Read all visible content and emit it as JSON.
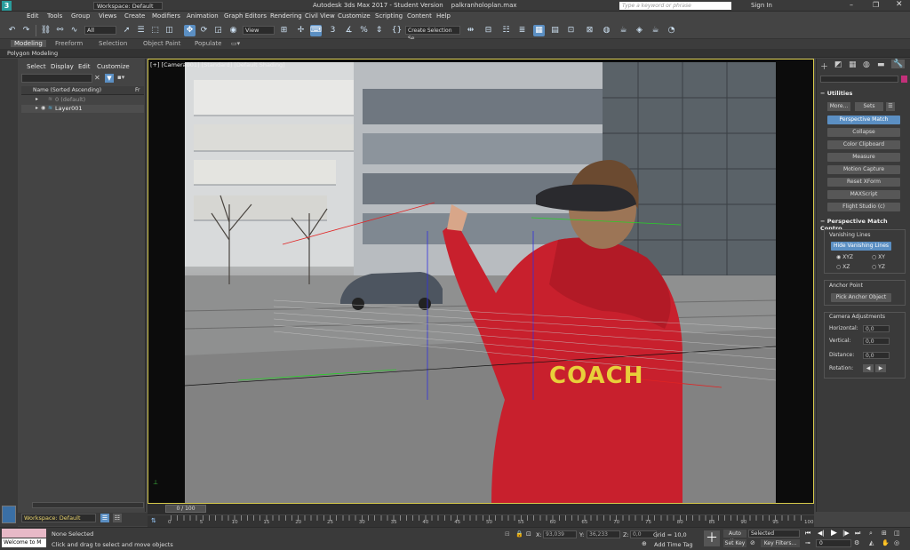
{
  "title": {
    "workspace": "Workspace: Default",
    "window_title": "Autodesk 3ds Max 2017 - Student Version",
    "file": "palkranholoplan.max",
    "search_placeholder": "Type a keyword or phrase",
    "signin": "Sign In"
  },
  "menu": [
    "Edit",
    "Tools",
    "Group",
    "Views",
    "Create",
    "Modifiers",
    "Animation",
    "Graph Editors",
    "Rendering",
    "Civil View",
    "Customize",
    "Scripting",
    "Content",
    "Help"
  ],
  "toolbar": {
    "filter": "All",
    "view": "View",
    "snap": "3",
    "selection_set": "Create Selection Se"
  },
  "ribbon": {
    "tabs": [
      "Modeling",
      "Freeform",
      "Selection",
      "Object Paint",
      "Populate"
    ],
    "sub": "Polygon Modeling"
  },
  "scene": {
    "menu": [
      "Select",
      "Display",
      "Edit",
      "Customize"
    ],
    "column": "Name (Sorted Ascending)",
    "col2": "Fr",
    "rows": [
      "0 (default)",
      "Layer001"
    ],
    "footer_workspace": "Workspace: Default"
  },
  "viewport": {
    "label": "[+] [Camera001] [Standard] [Default Shading]",
    "hoodie_text": "COACH"
  },
  "cmd": {
    "section_utilities": "Utilities",
    "more": "More...",
    "sets": "Sets",
    "buttons": [
      "Perspective Match",
      "Collapse",
      "Color Clipboard",
      "Measure",
      "Motion Capture",
      "Reset XForm",
      "MAXScript",
      "Flight Studio (c)"
    ],
    "section_pm": "Perspective Match Contro",
    "vanishing": "Vanishing Lines",
    "hide_lines": "Hide Vanishing Lines",
    "radio": [
      "XYZ",
      "XY",
      "XZ",
      "YZ"
    ],
    "anchor": "Anchor Point",
    "pick_anchor": "Pick Anchor Object",
    "cam_adj": "Camera Adjustments",
    "horizontal": "Horizontal:",
    "vertical": "Vertical:",
    "distance": "Distance:",
    "rotation": "Rotation:",
    "zero": "0,0"
  },
  "timeline": {
    "frame": "0 / 100",
    "ticks": [
      "0",
      "5",
      "10",
      "15",
      "20",
      "25",
      "30",
      "35",
      "40",
      "45",
      "50",
      "55",
      "60",
      "65",
      "70",
      "75",
      "80",
      "85",
      "90",
      "95",
      "100"
    ]
  },
  "status": {
    "maxscript": "Welcome to M",
    "none_selected": "None Selected",
    "prompt": "Click and drag to select and move objects",
    "x": "X:",
    "y": "Y:",
    "z": "Z:",
    "x_val": "93,039",
    "y_val": "36,233",
    "z_val": "0,0",
    "grid": "Grid = 10,0",
    "add_time_tag": "Add Time Tag",
    "auto_key": "Auto Key",
    "selected": "Selected",
    "set_key": "Set Key",
    "key_filters": "Key Filters...",
    "frame_field": "0"
  }
}
